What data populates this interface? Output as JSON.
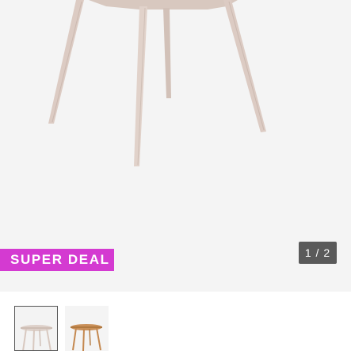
{
  "gallery": {
    "badge": "SUPER DEAL",
    "counter": "1 / 2",
    "current_slide": 1,
    "total_slides": 2
  },
  "thumbnails": [
    {
      "product": "round dining table, white-washed oak",
      "selected": true
    },
    {
      "product": "round dining table, natural oak",
      "selected": false
    }
  ],
  "colors": {
    "badge_background": "#d43ad1",
    "counter_background": "#5a5a5a",
    "gallery_background": "#f4f4f4",
    "wood_whitewashed": "#dcccc4",
    "wood_natural": "#c98f58"
  }
}
